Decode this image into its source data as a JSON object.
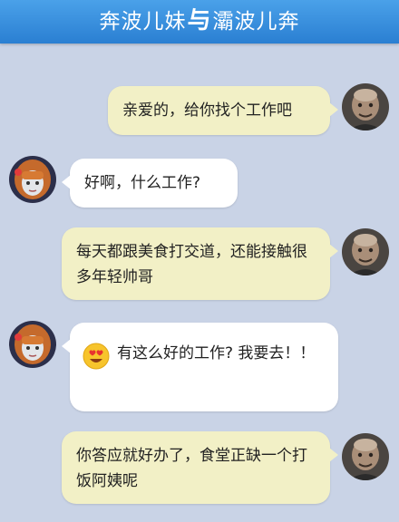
{
  "header": {
    "title_left": "奔波儿妹",
    "separator": "与",
    "title_right": "灞波儿奔"
  },
  "colors": {
    "header": "#2f86d8",
    "background": "#c9d3e6",
    "bubble_right": "#f2f0c6",
    "bubble_left": "#ffffff"
  },
  "messages": [
    {
      "side": "right",
      "sender": "灞波儿奔",
      "text": "亲爱的，给你找个工作吧"
    },
    {
      "side": "left",
      "sender": "奔波儿妹",
      "text": "好啊，什么工作?"
    },
    {
      "side": "right",
      "sender": "灞波儿奔",
      "text": "每天都跟美食打交道，还能接触很多年轻帅哥"
    },
    {
      "side": "left",
      "sender": "奔波儿妹",
      "emoji": "heart-eyes-emoji",
      "text": "有这么好的工作? 我要去！！"
    },
    {
      "side": "right",
      "sender": "灞波儿奔",
      "text": "你答应就好办了，食堂正缺一个打饭阿姨呢"
    }
  ]
}
